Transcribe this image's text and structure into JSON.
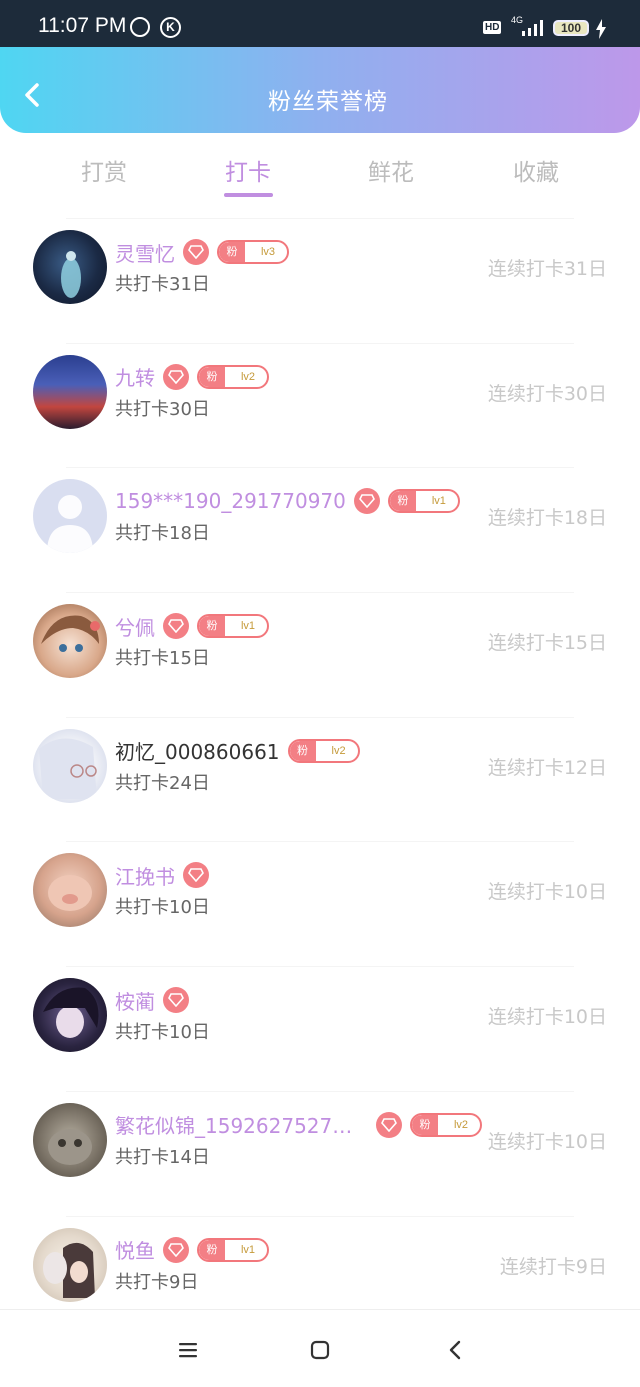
{
  "status_bar": {
    "time": "11:07 PM",
    "network": "4G",
    "hd": "HD",
    "battery": "100",
    "icons": [
      "alarm-icon",
      "k-app-icon",
      "signal-icon",
      "battery-icon",
      "charging-icon"
    ]
  },
  "header": {
    "title": "粉丝荣誉榜",
    "back_icon": "chevron-left-icon"
  },
  "tabs": [
    {
      "label": "打赏",
      "active": false
    },
    {
      "label": "打卡",
      "active": true
    },
    {
      "label": "鲜花",
      "active": false
    },
    {
      "label": "收藏",
      "active": false
    }
  ],
  "fans": [
    {
      "name": "灵雪忆",
      "name_color": "purple",
      "fan_badge": "粉",
      "level": "lv3",
      "total": "共打卡31日",
      "streak": "连续打卡31日"
    },
    {
      "name": "九转",
      "name_color": "purple",
      "fan_badge": "粉",
      "level": "lv2",
      "total": "共打卡30日",
      "streak": "连续打卡30日"
    },
    {
      "name": "159***190_291770970",
      "name_color": "purple",
      "fan_badge": "粉",
      "level": "lv1",
      "total": "共打卡18日",
      "streak": "连续打卡18日"
    },
    {
      "name": "兮佩",
      "name_color": "purple",
      "fan_badge": "粉",
      "level": "lv1",
      "total": "共打卡15日",
      "streak": "连续打卡15日"
    },
    {
      "name": "初忆_000860661",
      "name_color": "dark",
      "fan_badge": "粉",
      "level": "lv2",
      "total": "共打卡24日",
      "streak": "连续打卡12日"
    },
    {
      "name": "江挽书",
      "name_color": "purple",
      "fan_badge": "",
      "level": "",
      "total": "共打卡10日",
      "streak": "连续打卡10日"
    },
    {
      "name": "桉蔺",
      "name_color": "purple",
      "fan_badge": "",
      "level": "",
      "total": "共打卡10日",
      "streak": "连续打卡10日"
    },
    {
      "name": "繁花似锦_15926275271...",
      "name_color": "purple",
      "fan_badge": "粉",
      "level": "lv2",
      "total": "共打卡14日",
      "streak": "连续打卡10日"
    },
    {
      "name": "悦鱼",
      "name_color": "purple",
      "fan_badge": "粉",
      "level": "lv1",
      "total": "共打卡9日",
      "streak": "连续打卡9日"
    }
  ],
  "nav_bar": {
    "icons": [
      "menu-icon",
      "home-square-icon",
      "back-triangle-icon"
    ]
  },
  "colors": {
    "accent_purple": "#c08ee0",
    "badge_red": "#f37f85",
    "header_gradient": [
      "#4fd6f2",
      "#8fb0ef",
      "#bd98ea"
    ]
  }
}
